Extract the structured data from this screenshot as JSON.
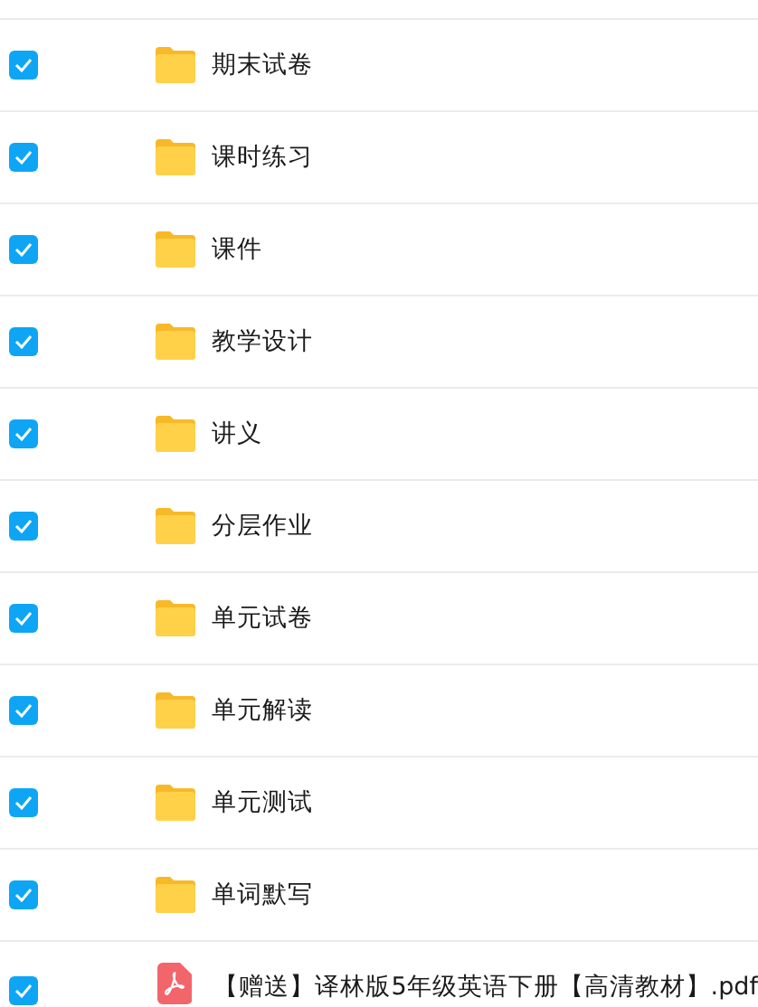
{
  "files": [
    {
      "kind": "folder",
      "name": "期末试卷",
      "checked": true
    },
    {
      "kind": "folder",
      "name": "课时练习",
      "checked": true
    },
    {
      "kind": "folder",
      "name": "课件",
      "checked": true
    },
    {
      "kind": "folder",
      "name": "教学设计",
      "checked": true
    },
    {
      "kind": "folder",
      "name": "讲义",
      "checked": true
    },
    {
      "kind": "folder",
      "name": "分层作业",
      "checked": true
    },
    {
      "kind": "folder",
      "name": "单元试卷",
      "checked": true
    },
    {
      "kind": "folder",
      "name": "单元解读",
      "checked": true
    },
    {
      "kind": "folder",
      "name": "单元测试",
      "checked": true
    },
    {
      "kind": "folder",
      "name": "单词默写",
      "checked": true
    },
    {
      "kind": "pdf",
      "name": "【赠送】译林版5年级英语下册【高清教材】.pdf",
      "checked": true
    }
  ]
}
